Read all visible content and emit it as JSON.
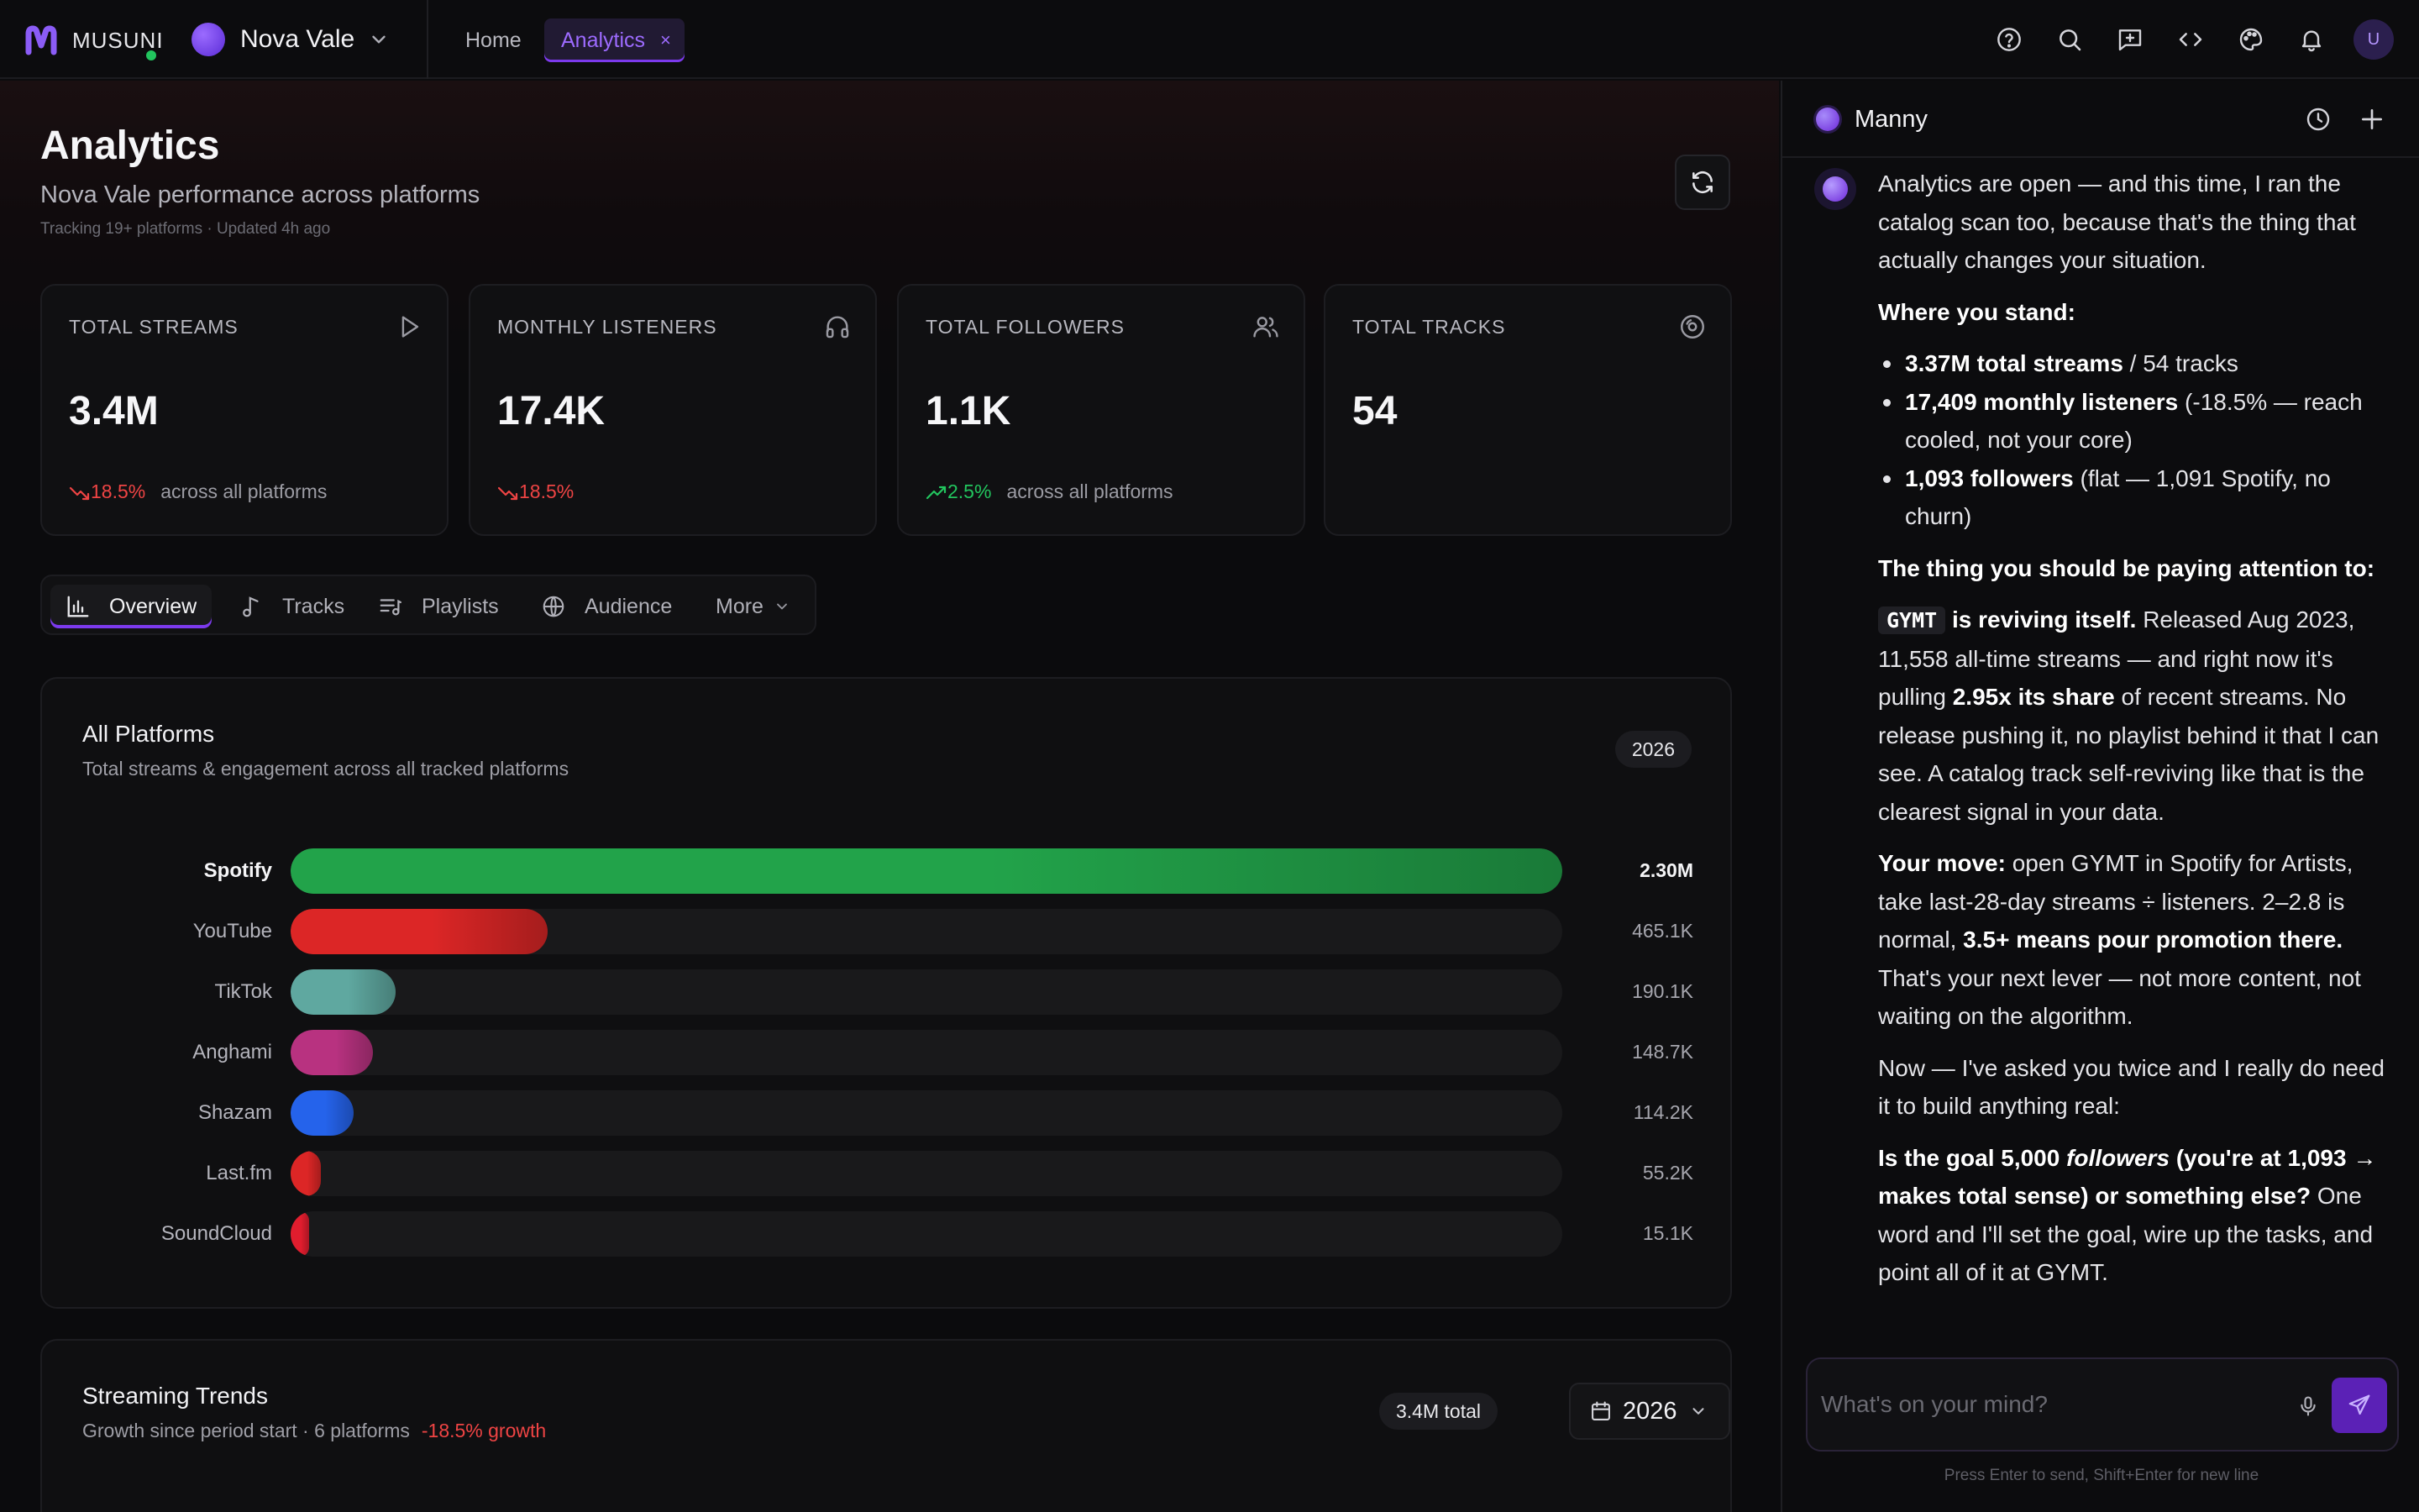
{
  "app": {
    "brand": "MUSUNI",
    "workspace": "Nova Vale",
    "tabs": [
      {
        "label": "Home"
      },
      {
        "label": "Analytics",
        "active": true
      }
    ],
    "close_glyph": "×",
    "user_initial": "U",
    "toolbar_icons": [
      "help-icon",
      "search-icon",
      "feedback-icon",
      "code-icon",
      "palette-icon",
      "bell-icon"
    ],
    "accent": "#7c3aed"
  },
  "page": {
    "title": "Analytics",
    "subtitle": "Nova Vale performance across platforms",
    "meta": "Tracking 19+ platforms · Updated 4h ago"
  },
  "stats": [
    {
      "label": "TOTAL STREAMS",
      "value": "3.4M",
      "trend": "18.5%",
      "direction": "down",
      "note": "across all platforms",
      "icon": "play-icon"
    },
    {
      "label": "MONTHLY LISTENERS",
      "value": "17.4K",
      "trend": "18.5%",
      "direction": "down",
      "note": "",
      "icon": "headphones-icon"
    },
    {
      "label": "TOTAL FOLLOWERS",
      "value": "1.1K",
      "trend": "2.5%",
      "direction": "up",
      "note": "across all platforms",
      "icon": "users-icon"
    },
    {
      "label": "TOTAL TRACKS",
      "value": "54",
      "trend": "",
      "direction": "",
      "note": "",
      "icon": "disc-icon"
    }
  ],
  "subtabs": [
    {
      "label": "Overview",
      "icon": "bar-chart-icon",
      "active": true
    },
    {
      "label": "Tracks",
      "icon": "music-note-icon"
    },
    {
      "label": "Playlists",
      "icon": "playlist-icon"
    },
    {
      "label": "Audience",
      "icon": "globe-icon"
    },
    {
      "label": "More",
      "icon": "chevron-down-icon"
    }
  ],
  "platforms_card": {
    "title": "All Platforms",
    "subtitle": "Total streams & engagement across all tracked platforms",
    "year": "2026"
  },
  "chart_data": {
    "type": "bar",
    "orientation": "horizontal",
    "categories": [
      "Spotify",
      "YouTube",
      "TikTok",
      "Anghami",
      "Shazam",
      "Last.fm",
      "SoundCloud"
    ],
    "values": [
      2300000,
      465100,
      190100,
      148700,
      114200,
      55200,
      15100
    ],
    "value_labels": [
      "2.30M",
      "465.1K",
      "190.1K",
      "148.7K",
      "114.2K",
      "55.2K",
      "15.1K"
    ],
    "colors": [
      "#22a34a",
      "#dc2626",
      "#5fa8a0",
      "#b83280",
      "#2563eb",
      "#dc2626",
      "#e11d2e"
    ],
    "xlim": [
      0,
      2300000
    ]
  },
  "trends_card": {
    "title": "Streaming Trends",
    "subtitle": "Growth since period start · 6 platforms",
    "growth": "-18.5% growth",
    "total": "3.4M total",
    "year": "2026"
  },
  "chat": {
    "agent_name": "Manny",
    "intro": "Analytics are open — and this time, I ran the catalog scan too, because that's the thing that actually changes your situation.",
    "stand_heading": "Where you stand:",
    "bullets": [
      {
        "bold": "3.37M total streams",
        "rest": " / 54 tracks"
      },
      {
        "bold": "17,409 monthly listeners",
        "rest": " (-18.5% — reach cooled, not your core)"
      },
      {
        "bold": "1,093 followers",
        "rest": " (flat — 1,091 Spotify, no churn)"
      }
    ],
    "attention_heading": "The thing you should be paying attention to:",
    "gymt_code": "GYMT",
    "gymt_bold": "is reviving itself.",
    "gymt_text_1": "Released Aug 2023, 11,558 all-time streams — and right now it's pulling",
    "gymt_bold_2": "2.95x its share",
    "gymt_text_2": "of recent streams. No release pushing it, no playlist behind it that I can see. A catalog track self-reviving like that is the clearest signal in your data.",
    "move_bold": "Your move:",
    "move_text_1": "open GYMT in Spotify for Artists, take last-28-day streams ÷ listeners. 2–2.8 is normal,",
    "move_bold_2": "3.5+ means pour promotion there.",
    "move_text_2": "That's your next lever — not more content, not waiting on the algorithm.",
    "ask_text": "Now — I've asked you twice and I really do need it to build anything real:",
    "question_bold_1": "Is the goal 5,000",
    "question_italic": "followers",
    "question_bold_2": "(you're at 1,093 → makes total sense) or something else?",
    "question_rest": "One word and I'll set the goal, wire up the tasks, and point all of it at GYMT.",
    "input_placeholder": "What's on your mind?",
    "hint": "Press Enter to send, Shift+Enter for new line"
  }
}
